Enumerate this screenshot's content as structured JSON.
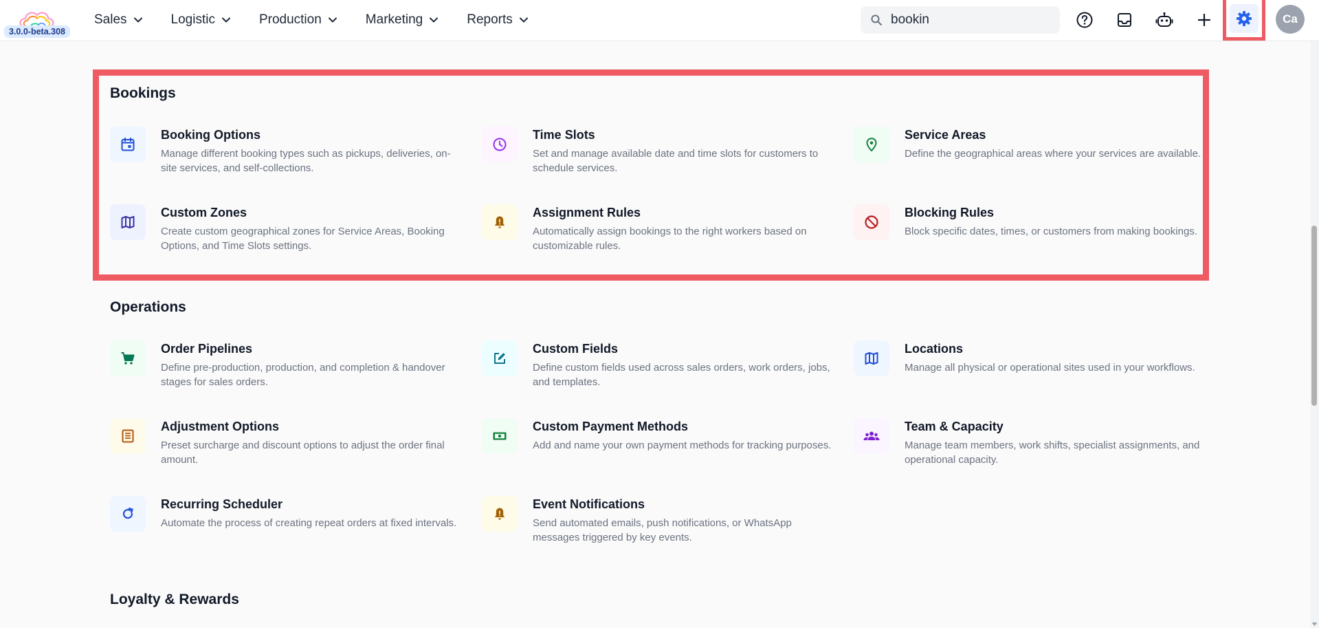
{
  "app": {
    "version": "3.0.0-beta.308"
  },
  "nav": {
    "items": [
      "Sales",
      "Logistic",
      "Production",
      "Marketing",
      "Reports"
    ]
  },
  "search": {
    "value": "bookin",
    "placeholder": ""
  },
  "header_icons": [
    "help-circle-icon",
    "inbox-icon",
    "robot-icon",
    "plus-icon",
    "gear-icon"
  ],
  "user": {
    "initials": "Ca"
  },
  "colors": {
    "highlight": "#ef5b63",
    "settings_accent": "#2563eb"
  },
  "sections": [
    {
      "title": "Bookings",
      "items": [
        {
          "title": "Booking Options",
          "desc": "Manage different booking types such as pickups, deliveries, on-site services, and self-collections.",
          "icon": "calendar-icon"
        },
        {
          "title": "Time Slots",
          "desc": "Set and manage available date and time slots for customers to schedule services.",
          "icon": "clock-icon"
        },
        {
          "title": "Service Areas",
          "desc": "Define the geographical areas where your services are available.",
          "icon": "location-pin-icon"
        },
        {
          "title": "Custom Zones",
          "desc": "Create custom geographical zones for Service Areas, Booking Options, and Time Slots settings.",
          "icon": "map-icon"
        },
        {
          "title": "Assignment Rules",
          "desc": "Automatically assign bookings to the right workers based on customizable rules.",
          "icon": "bell-alert-icon"
        },
        {
          "title": "Blocking Rules",
          "desc": "Block specific dates, times, or customers from making bookings.",
          "icon": "block-icon"
        }
      ]
    },
    {
      "title": "Operations",
      "items": [
        {
          "title": "Order Pipelines",
          "desc": "Define pre-production, production, and completion & handover stages for sales orders.",
          "icon": "cart-icon"
        },
        {
          "title": "Custom Fields",
          "desc": "Define custom fields used across sales orders, work orders, jobs, and templates.",
          "icon": "edit-icon"
        },
        {
          "title": "Locations",
          "desc": "Manage all physical or operational sites used in your workflows.",
          "icon": "map-icon"
        },
        {
          "title": "Adjustment Options",
          "desc": "Preset surcharge and discount options to adjust the order final amount.",
          "icon": "list-icon"
        },
        {
          "title": "Custom Payment Methods",
          "desc": "Add and name your own payment methods for tracking purposes.",
          "icon": "cash-icon"
        },
        {
          "title": "Team & Capacity",
          "desc": "Manage team members, work shifts, specialist assignments, and operational capacity.",
          "icon": "people-icon"
        },
        {
          "title": "Recurring Scheduler",
          "desc": "Automate the process of creating repeat orders at fixed intervals.",
          "icon": "refresh-icon"
        },
        {
          "title": "Event Notifications",
          "desc": "Send automated emails, push notifications, or WhatsApp messages triggered by key events.",
          "icon": "bell-alert-icon"
        }
      ]
    },
    {
      "title": "Loyalty & Rewards",
      "items": []
    }
  ]
}
